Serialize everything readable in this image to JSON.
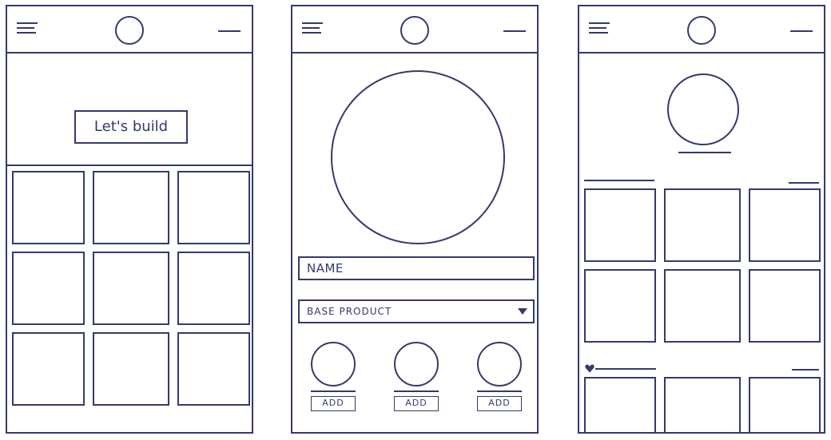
{
  "screens": [
    {
      "id": "home",
      "hero_label": "Let's build",
      "tile_count": 9
    },
    {
      "id": "builder",
      "name_field_value": "NAME",
      "select_value": "BASE PRODUCT",
      "addons": [
        {
          "button_label": "ADD"
        },
        {
          "button_label": "ADD"
        },
        {
          "button_label": "ADD"
        }
      ]
    },
    {
      "id": "profile",
      "sections": [
        {
          "icon": "none",
          "tile_count": 6
        },
        {
          "icon": "heart-icon",
          "tile_count": 3
        }
      ]
    }
  ],
  "header_icons": {
    "left": "menu-icon",
    "center": "logo-circle",
    "right": "more-line"
  },
  "colors": {
    "ink": "#343a6b",
    "paper": "#ffffff"
  }
}
